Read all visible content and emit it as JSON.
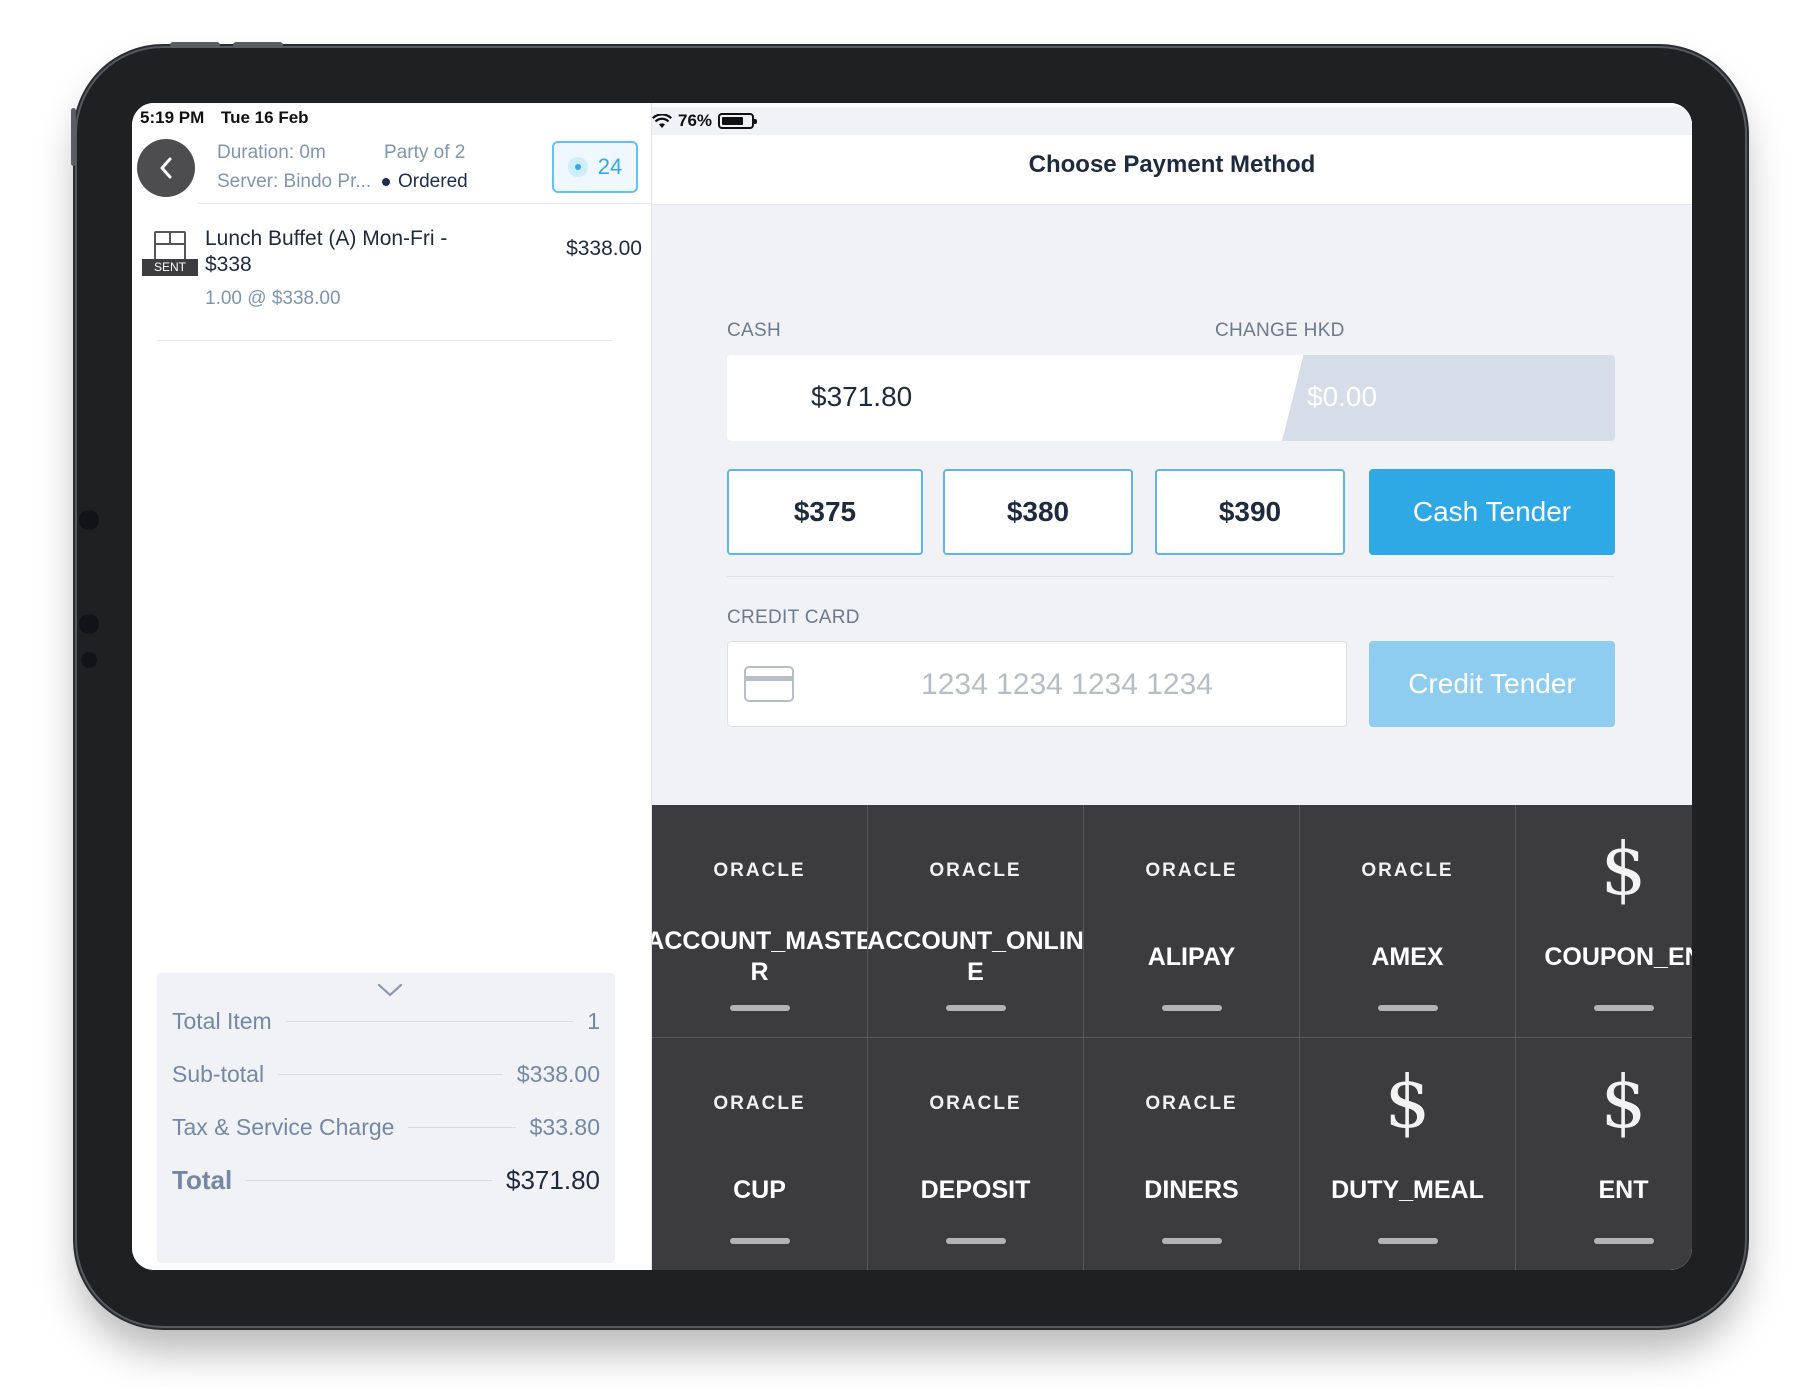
{
  "status_bar": {
    "time": "5:19 PM",
    "date": "Tue 16 Feb",
    "battery": "76%",
    "battery_level": 0.76
  },
  "order": {
    "duration": "Duration: 0m",
    "party": "Party of 2",
    "server": "Server: Bindo Pr...",
    "status": "Ordered",
    "guest_count": "24",
    "items": [
      {
        "name": "Lunch Buffet (A) Mon-Fri - $338",
        "price": "$338.00",
        "qty_line": "1.00 @ $338.00",
        "tag": "SENT"
      }
    ],
    "summary": {
      "total_item_label": "Total Item",
      "total_item_value": "1",
      "subtotal_label": "Sub-total",
      "subtotal_value": "$338.00",
      "tax_label": "Tax & Service Charge",
      "tax_value": "$33.80",
      "total_label": "Total",
      "total_value": "$371.80"
    }
  },
  "payment": {
    "title": "Choose Payment Method",
    "cash_label": "CASH",
    "change_label": "CHANGE HKD",
    "cash_value": "$371.80",
    "change_value": "$0.00",
    "quick_amounts": [
      "$375",
      "$380",
      "$390"
    ],
    "cash_tender": "Cash Tender",
    "credit_label": "CREDIT CARD",
    "card_placeholder": "1234 1234 1234 1234",
    "credit_tender": "Credit Tender"
  },
  "tenders": [
    {
      "logo": "ORACLE",
      "icon": "oracle-logo",
      "name": "ACCOUNT_MASTER"
    },
    {
      "logo": "ORACLE",
      "icon": "oracle-logo",
      "name": "ACCOUNT_ONLINE"
    },
    {
      "logo": "ORACLE",
      "icon": "oracle-logo",
      "name": "ALIPAY"
    },
    {
      "logo": "ORACLE",
      "icon": "oracle-logo",
      "name": "AMEX"
    },
    {
      "logo": "$",
      "icon": "dollar-icon",
      "name": "COUPON_EN"
    },
    {
      "logo": "ORACLE",
      "icon": "oracle-logo",
      "name": "CUP"
    },
    {
      "logo": "ORACLE",
      "icon": "oracle-logo",
      "name": "DEPOSIT"
    },
    {
      "logo": "ORACLE",
      "icon": "oracle-logo",
      "name": "DINERS"
    },
    {
      "logo": "$",
      "icon": "dollar-icon",
      "name": "DUTY_MEAL"
    },
    {
      "logo": "$",
      "icon": "dollar-icon",
      "name": "ENT"
    }
  ],
  "colors": {
    "accent": "#2fa8e6",
    "accent_disabled": "#8ecdf0",
    "grid_bg": "#3c3c3e",
    "text_muted": "#7f95b0"
  }
}
